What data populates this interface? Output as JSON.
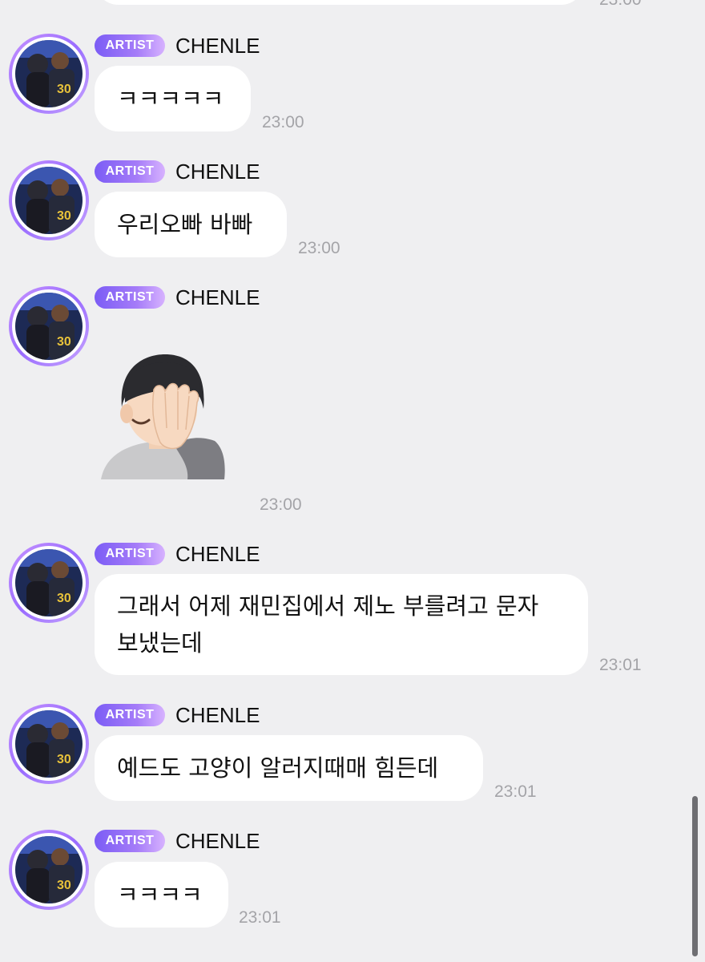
{
  "top_partial": {
    "time_fragment": "23:00"
  },
  "sender": {
    "badge": "ARTIST",
    "name": "CHENLE"
  },
  "messages": [
    {
      "text": "ㅋㅋㅋㅋㅋ",
      "time": "23:00"
    },
    {
      "text": "우리오빠 바빠",
      "time": "23:00"
    },
    {
      "emoji": "facepalm-emoji",
      "time": "23:00"
    },
    {
      "line1": "그래서 어제 재민집에서 제노 부를려고 문자",
      "line2": "보냈는데",
      "time": "23:01"
    },
    {
      "text": "예드도 고양이 알러지때매 힘든데",
      "time": "23:01"
    },
    {
      "text": "ㅋㅋㅋㅋ",
      "time": "23:01"
    }
  ],
  "colors": {
    "background": "#efeff1",
    "bubble": "#ffffff",
    "badge_start": "#7b5cf5",
    "badge_end": "#d7b2ff",
    "timestamp": "#a4a4a8"
  }
}
